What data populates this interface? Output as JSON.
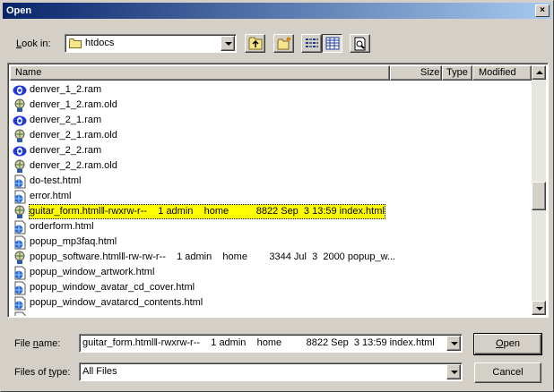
{
  "window": {
    "title": "Open",
    "close_glyph": "×"
  },
  "lookin": {
    "label": "Look in:",
    "value": "htdocs"
  },
  "toolbar": {
    "up_icon": "up-folder-icon",
    "new_folder_icon": "new-folder-icon",
    "list_icon": "list-view-icon",
    "details_icon": "details-view-icon",
    "preview_icon": "preview-icon"
  },
  "columns": {
    "name": "Name",
    "size": "Size",
    "type": "Type",
    "modified": "Modified"
  },
  "files": [
    {
      "name": "denver_1_2.ram",
      "icon": "realaudio-icon"
    },
    {
      "name": "denver_1_2.ram.old",
      "icon": "generic-file-icon"
    },
    {
      "name": "denver_2_1.ram",
      "icon": "realaudio-icon"
    },
    {
      "name": "denver_2_1.ram.old",
      "icon": "generic-file-icon"
    },
    {
      "name": "denver_2_2.ram",
      "icon": "realaudio-icon"
    },
    {
      "name": "denver_2_2.ram.old",
      "icon": "generic-file-icon"
    },
    {
      "name": "do-test.html",
      "icon": "html-icon"
    },
    {
      "name": "error.html",
      "icon": "html-icon"
    },
    {
      "name": "guitar_form.html‖-rwxrw-r--    1 admin    home          8822 Sep  3 13:59 index.html",
      "icon": "generic-file-icon",
      "selected": true
    },
    {
      "name": "orderform.html",
      "icon": "html-icon"
    },
    {
      "name": "popup_mp3faq.html",
      "icon": "html-icon"
    },
    {
      "name": "popup_software.html‖-rw-rw-r--    1 admin    home        3344 Jul  3  2000 popup_w...",
      "icon": "generic-file-icon"
    },
    {
      "name": "popup_window_artwork.html",
      "icon": "html-icon"
    },
    {
      "name": "popup_window_avatar_cd_cover.html",
      "icon": "html-icon"
    },
    {
      "name": "popup_window_avatarcd_contents.html",
      "icon": "html-icon"
    }
  ],
  "filename": {
    "label": "File name:",
    "value": "guitar_form.html‖-rwxrw-r--    1 admin    home         8822 Sep  3 13:59 index.html"
  },
  "filetype": {
    "label": "Files of type:",
    "value": "All Files"
  },
  "buttons": {
    "open": "Open",
    "cancel": "Cancel"
  }
}
